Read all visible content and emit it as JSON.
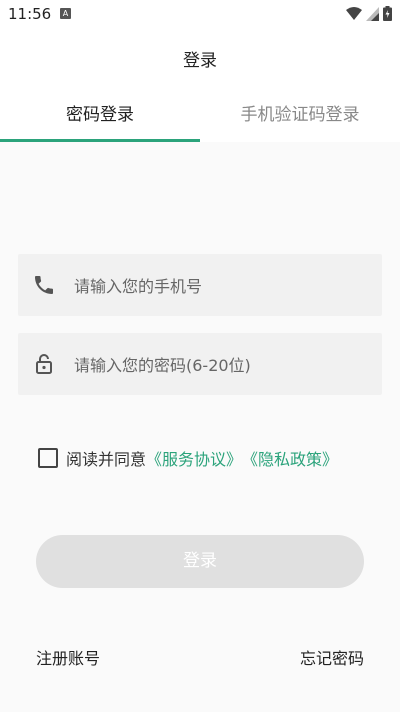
{
  "status_bar": {
    "time": "11:56",
    "notification_icon": "A"
  },
  "header": {
    "title": "登录"
  },
  "tabs": [
    {
      "label": "密码登录",
      "active": true
    },
    {
      "label": "手机验证码登录",
      "active": false
    }
  ],
  "form": {
    "phone_placeholder": "请输入您的手机号",
    "password_placeholder": "请输入您的密码(6-20位)",
    "phone_icon": "phone-icon",
    "lock_icon": "lock-icon"
  },
  "agreement": {
    "checked": false,
    "prefix": "阅读并同意",
    "service_link": "《服务协议》",
    "privacy_link": "《隐私政策》"
  },
  "login_button": "登录",
  "links": {
    "register": "注册账号",
    "forgot": "忘记密码"
  },
  "colors": {
    "accent": "#2ba37b",
    "button_disabled": "#e0e0e0"
  }
}
